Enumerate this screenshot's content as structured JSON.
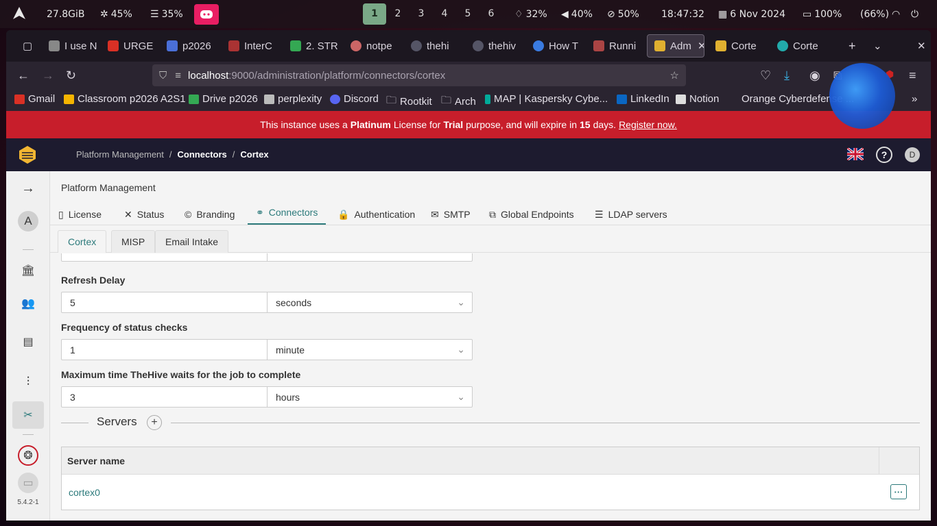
{
  "system_bar": {
    "memory": "27.8GiB",
    "cpu": "45%",
    "ram": "35%",
    "workspaces": [
      "1",
      "2",
      "3",
      "4",
      "5",
      "6"
    ],
    "active_workspace": "1",
    "brightness": "32%",
    "volume": "40%",
    "mic": "50%",
    "time": "18:47:32",
    "date": "6 Nov 2024",
    "battery": "100%",
    "wifi": "(66%)"
  },
  "browser": {
    "tabs": [
      {
        "label": "I use N"
      },
      {
        "label": "URGE"
      },
      {
        "label": "p2026"
      },
      {
        "label": "InterC"
      },
      {
        "label": "2. STR"
      },
      {
        "label": "notpe"
      },
      {
        "label": "thehi"
      },
      {
        "label": "thehiv"
      },
      {
        "label": "How T"
      },
      {
        "label": "Runni"
      },
      {
        "label": "Adm"
      },
      {
        "label": "Corte"
      },
      {
        "label": "Corte"
      }
    ],
    "url_host": "localhost",
    "url_path": ":9000/administration/platform/connectors/cortex",
    "bookmarks": [
      "Gmail",
      "Classroom p2026 A2S1",
      "Drive p2026",
      "perplexity",
      "Discord",
      "Rootkit",
      "Arch",
      "MAP | Kaspersky Cybe...",
      "LinkedIn",
      "Notion",
      "Orange Cyberdefense ..."
    ]
  },
  "banner": {
    "prefix": "This instance uses a",
    "plan": "Platinum",
    "mid": "License for",
    "purpose": "Trial",
    "mid2": "purpose, and will expire in",
    "days": "15",
    "suffix": "days.",
    "register": "Register now."
  },
  "header": {
    "crumbs": [
      "Platform Management",
      "Connectors",
      "Cortex"
    ],
    "user_initial": "D"
  },
  "sidebar": {
    "avatar": "A",
    "version": "5.4.2-1"
  },
  "content": {
    "title": "Platform Management",
    "tabs": [
      "License",
      "Status",
      "Branding",
      "Connectors",
      "Authentication",
      "SMTP",
      "Global Endpoints",
      "LDAP servers"
    ],
    "sub_tabs": [
      "Cortex",
      "MISP",
      "Email Intake"
    ],
    "fields": [
      {
        "label": "Refresh Delay",
        "value": "5",
        "unit": "seconds"
      },
      {
        "label": "Frequency of status checks",
        "value": "1",
        "unit": "minute"
      },
      {
        "label": "Maximum time TheHive waits for the job to complete",
        "value": "3",
        "unit": "hours"
      }
    ],
    "servers_title": "Servers",
    "table_header": "Server name",
    "server_row": "cortex0"
  },
  "colors": {
    "accent": "#2c7a7b",
    "banner_red": "#c71e2b",
    "header_navy": "#1d1b2f"
  }
}
